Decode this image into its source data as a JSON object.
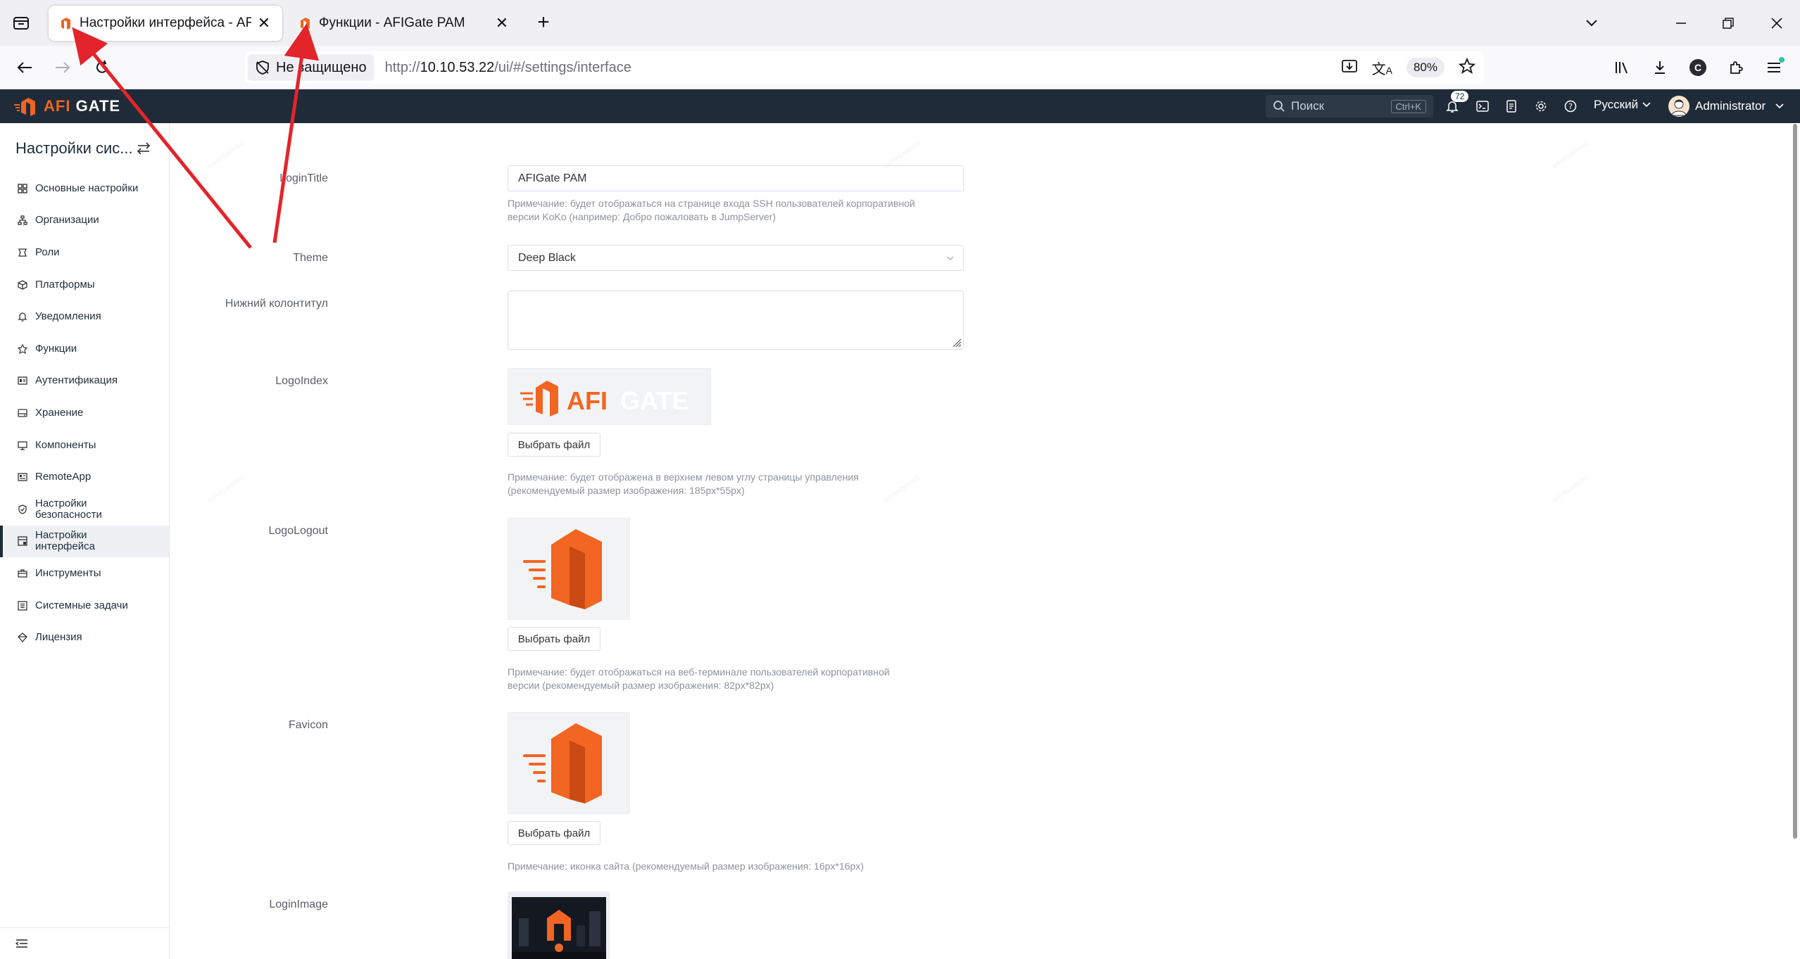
{
  "browser": {
    "tabs": [
      {
        "title": "Настройки интерфейса - AFIGate PAM",
        "active": true
      },
      {
        "title": "Функции - AFIGate PAM",
        "active": false
      }
    ],
    "security_label": "Не защищено",
    "url": {
      "scheme": "http://",
      "host": "10.10.53.22",
      "path": "/ui/#/settings/interface"
    },
    "zoom": "80%",
    "profile_initial": "C"
  },
  "app": {
    "brand": {
      "part1": "AFI",
      "part2": "GATE"
    },
    "search": {
      "placeholder": "Поиск",
      "shortcut": "Ctrl+K"
    },
    "notifications_count": "72",
    "language": "Русский",
    "user": "Administrator",
    "accent_color": "#f26522",
    "header_color": "#1f2b38"
  },
  "sidebar": {
    "title": "Настройки сис...",
    "items": [
      {
        "label": "Основные настройки",
        "icon": "grid-icon"
      },
      {
        "label": "Организации",
        "icon": "org-tree-icon"
      },
      {
        "label": "Роли",
        "icon": "role-icon"
      },
      {
        "label": "Платформы",
        "icon": "cube-icon"
      },
      {
        "label": "Уведомления",
        "icon": "bell-icon"
      },
      {
        "label": "Функции",
        "icon": "features-icon"
      },
      {
        "label": "Аутентификация",
        "icon": "auth-icon"
      },
      {
        "label": "Хранение",
        "icon": "storage-icon"
      },
      {
        "label": "Компоненты",
        "icon": "monitor-icon"
      },
      {
        "label": "RemoteApp",
        "icon": "remoteapp-icon"
      },
      {
        "label": "Настройки безопасности",
        "line1": "Настройки",
        "line2": "безопасности",
        "icon": "shield-icon"
      },
      {
        "label": "Настройки интерфейса",
        "line1": "Настройки",
        "line2": "интерфейса",
        "icon": "interface-icon",
        "active": true
      },
      {
        "label": "Инструменты",
        "icon": "tools-icon"
      },
      {
        "label": "Системные задачи",
        "icon": "tasks-icon"
      },
      {
        "label": "Лицензия",
        "icon": "license-icon"
      }
    ]
  },
  "form": {
    "login_title": {
      "label": "LoginTitle",
      "value": "AFIGate PAM",
      "hint_line1": "Примечание: будет отображаться на странице входа SSH пользователей корпоративной",
      "hint_line2": "версии KoKo (например: Добро пожаловать в JumpServer)"
    },
    "theme": {
      "label": "Theme",
      "value": "Deep Black"
    },
    "footer": {
      "label": "Нижний колонтитул",
      "value": ""
    },
    "logo_index": {
      "label": "LogoIndex",
      "button": "Выбрать файл",
      "logo_text1": "AFI",
      "logo_text2": "GATE",
      "hint_line1": "Примечание: будет отображена в верхнем левом углу страницы управления",
      "hint_line2": "(рекомендуемый размер изображения: 185px*55px)"
    },
    "logo_logout": {
      "label": "LogoLogout",
      "button": "Выбрать файл",
      "hint_line1": "Примечание: будет отображаться на веб-терминале пользователей корпоративной",
      "hint_line2": "версии (рекомендуемый размер изображения: 82px*82px)"
    },
    "favicon": {
      "label": "Favicon",
      "button": "Выбрать файл",
      "hint_line1": "Примечание: иконка сайта (рекомендуемый размер изображения: 16px*16px)"
    },
    "login_image": {
      "label": "LoginImage"
    }
  }
}
